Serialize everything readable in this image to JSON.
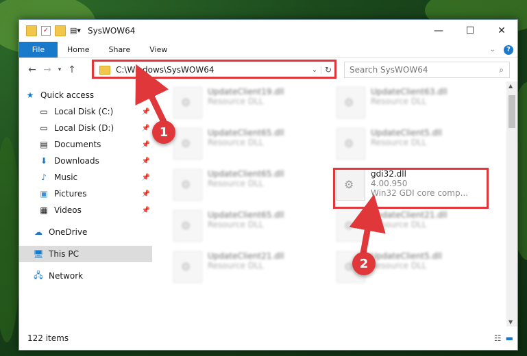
{
  "window": {
    "title": "SysWOW64",
    "min": "—",
    "max": "☐",
    "close": "✕"
  },
  "ribbon": {
    "tabs": [
      "File",
      "Home",
      "Share",
      "View"
    ]
  },
  "address": {
    "path": "C:\\Windows\\SysWOW64",
    "search_placeholder": "Search SysWOW64"
  },
  "sidebar": {
    "items": [
      {
        "label": "Quick access",
        "icon": "star-icon",
        "pinned": false
      },
      {
        "label": "Local Disk (C:)",
        "icon": "drive-icon",
        "pinned": true
      },
      {
        "label": "Local Disk (D:)",
        "icon": "drive-icon",
        "pinned": true
      },
      {
        "label": "Documents",
        "icon": "documents-icon",
        "pinned": true
      },
      {
        "label": "Downloads",
        "icon": "download-icon",
        "pinned": true
      },
      {
        "label": "Music",
        "icon": "music-icon",
        "pinned": true
      },
      {
        "label": "Pictures",
        "icon": "pictures-icon",
        "pinned": true
      },
      {
        "label": "Videos",
        "icon": "videos-icon",
        "pinned": true
      },
      {
        "label": "OneDrive",
        "icon": "cloud-icon",
        "pinned": false
      },
      {
        "label": "This PC",
        "icon": "computer-icon",
        "pinned": false,
        "selected": true
      },
      {
        "label": "Network",
        "icon": "network-icon",
        "pinned": false
      }
    ]
  },
  "files": [
    {
      "name": "UpdateClient19.dll",
      "desc": "Resource DLL"
    },
    {
      "name": "UpdateClient63.dll",
      "desc": "Resource DLL"
    },
    {
      "name": "UpdateClient65.dll",
      "desc": "Resource DLL"
    },
    {
      "name": "UpdateClient5.dll",
      "desc": "Resource DLL"
    },
    {
      "name": "UpdateClient65.dll",
      "desc": "Resource DLL"
    },
    {
      "name": "gdi32.dll",
      "version": "4.00.950",
      "desc": "Win32 GDI core comp..."
    },
    {
      "name": "UpdateClient65.dll",
      "desc": "Resource DLL"
    },
    {
      "name": "UpdateClient21.dll",
      "desc": "Resource DLL"
    },
    {
      "name": "UpdateClient21.dll",
      "desc": "Resource DLL"
    },
    {
      "name": "UpdateClient5.dll",
      "desc": "Resource DLL"
    }
  ],
  "status": {
    "count": "122 items"
  },
  "callouts": [
    "1",
    "2"
  ],
  "colors": {
    "accent": "#1979ca",
    "highlight": "#e0373b"
  }
}
